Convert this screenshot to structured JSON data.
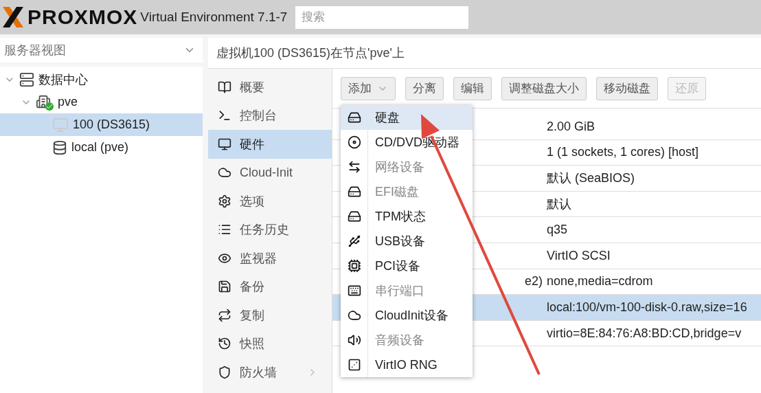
{
  "header": {
    "logo": "PROXMOX",
    "version": "Virtual Environment 7.1-7",
    "search": {
      "placeholder": "搜索"
    }
  },
  "sidebar": {
    "view_selector": "服务器视图",
    "tree": [
      {
        "label": "数据中心",
        "kind": "datacenter",
        "selected": false,
        "expanded": true,
        "children": [
          {
            "label": "pve",
            "kind": "node",
            "selected": false,
            "expanded": true,
            "children": [
              {
                "label": "100 (DS3615)",
                "kind": "vm",
                "selected": true
              },
              {
                "label": "local (pve)",
                "kind": "storage",
                "selected": false
              }
            ]
          }
        ]
      }
    ]
  },
  "panel_title": "虚拟机100 (DS3615)在节点'pve'上",
  "nav": [
    {
      "label": "概要",
      "kind": "book",
      "selected": false
    },
    {
      "label": "控制台",
      "kind": "terminal",
      "selected": false
    },
    {
      "label": "硬件",
      "kind": "monitor",
      "selected": true
    },
    {
      "label": "Cloud-Init",
      "kind": "cloud",
      "selected": false
    },
    {
      "label": "选项",
      "kind": "gear",
      "selected": false
    },
    {
      "label": "任务历史",
      "kind": "list",
      "selected": false
    },
    {
      "label": "监视器",
      "kind": "eye",
      "selected": false
    },
    {
      "label": "备份",
      "kind": "save",
      "selected": false
    },
    {
      "label": "复制",
      "kind": "repeat",
      "selected": false
    },
    {
      "label": "快照",
      "kind": "history",
      "selected": false
    },
    {
      "label": "防火墙",
      "kind": "shield",
      "selected": false,
      "has_submenu": true
    }
  ],
  "toolbar": [
    {
      "label": "添加",
      "dropdown": true,
      "disabled": false
    },
    {
      "label": "分离",
      "disabled": false
    },
    {
      "label": "编辑",
      "disabled": false
    },
    {
      "label": "调整磁盘大小",
      "disabled": false
    },
    {
      "label": "移动磁盘",
      "disabled": false
    },
    {
      "label": "还原",
      "disabled": true
    }
  ],
  "hardware_rows": [
    {
      "value": "2.00 GiB",
      "selected": false
    },
    {
      "value": "1 (1 sockets, 1 cores) [host]",
      "selected": false
    },
    {
      "value": "默认 (SeaBIOS)",
      "selected": false
    },
    {
      "value": "默认",
      "selected": false
    },
    {
      "value": "q35",
      "selected": false
    },
    {
      "value": "VirtIO SCSI",
      "selected": false
    },
    {
      "key": "e2)",
      "value": "none,media=cdrom",
      "selected": false
    },
    {
      "value": "local:100/vm-100-disk-0.raw,size=16",
      "selected": true
    },
    {
      "value": "virtio=8E:84:76:A8:BD:CD,bridge=v",
      "selected": false
    }
  ],
  "add_menu": [
    {
      "label": "硬盘",
      "kind": "disk",
      "selected": true,
      "disabled": false
    },
    {
      "label": "CD/DVD驱动器",
      "kind": "disc",
      "selected": false,
      "disabled": false
    },
    {
      "label": "网络设备",
      "kind": "network",
      "selected": false,
      "disabled": true
    },
    {
      "label": "EFI磁盘",
      "kind": "disk",
      "selected": false,
      "disabled": true
    },
    {
      "label": "TPM状态",
      "kind": "disk",
      "selected": false,
      "disabled": false
    },
    {
      "label": "USB设备",
      "kind": "usb",
      "selected": false,
      "disabled": false
    },
    {
      "label": "PCI设备",
      "kind": "pci",
      "selected": false,
      "disabled": false
    },
    {
      "label": "串行端口",
      "kind": "serial",
      "selected": false,
      "disabled": true
    },
    {
      "label": "CloudInit设备",
      "kind": "cloud",
      "selected": false,
      "disabled": false
    },
    {
      "label": "音频设备",
      "kind": "audio",
      "selected": false,
      "disabled": true
    },
    {
      "label": "VirtIO RNG",
      "kind": "dice",
      "selected": false,
      "disabled": false
    }
  ]
}
